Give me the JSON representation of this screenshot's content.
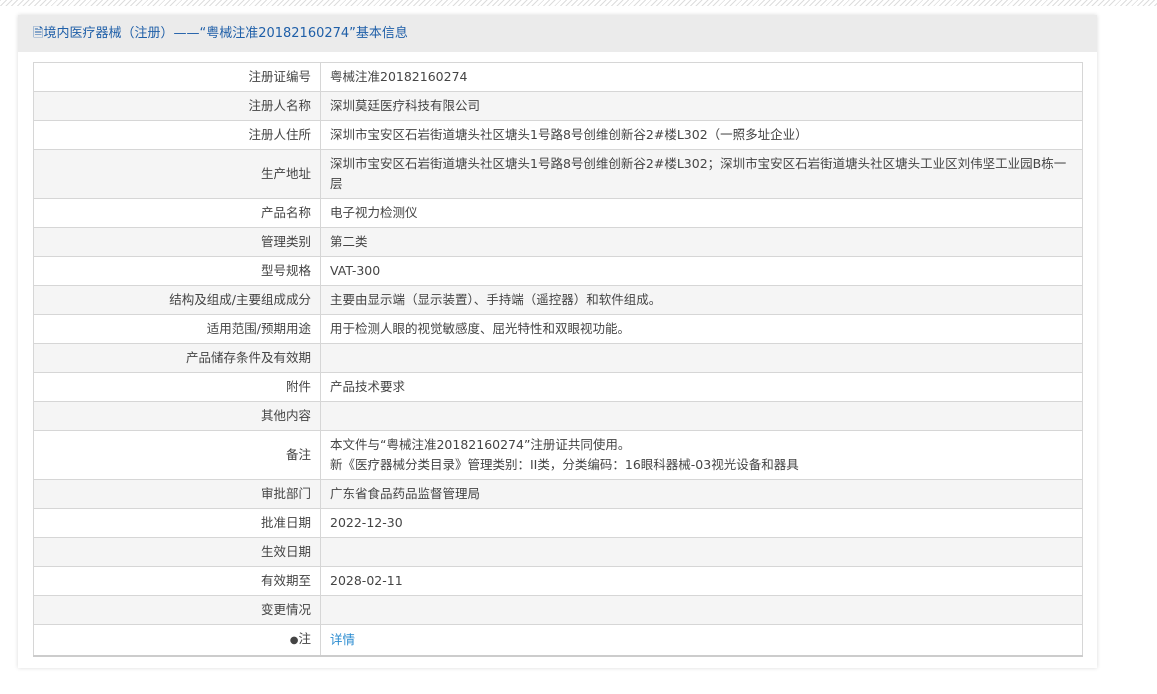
{
  "title": "境内医疗器械（注册）——“粤械注准20182160274”基本信息",
  "rows": [
    {
      "label": "注册证编号",
      "value": "粤械注准20182160274"
    },
    {
      "label": "注册人名称",
      "value": "深圳莫廷医疗科技有限公司"
    },
    {
      "label": "注册人住所",
      "value": "深圳市宝安区石岩街道塘头社区塘头1号路8号创维创新谷2#楼L302（一照多址企业）"
    },
    {
      "label": "生产地址",
      "value": "深圳市宝安区石岩街道塘头社区塘头1号路8号创维创新谷2#楼L302；深圳市宝安区石岩街道塘头社区塘头工业区刘伟坚工业园B栋一层"
    },
    {
      "label": "产品名称",
      "value": "电子视力检测仪"
    },
    {
      "label": "管理类别",
      "value": "第二类"
    },
    {
      "label": "型号规格",
      "value": "VAT-300"
    },
    {
      "label": "结构及组成/主要组成成分",
      "value": "主要由显示端（显示装置）、手持端（遥控器）和软件组成。"
    },
    {
      "label": "适用范围/预期用途",
      "value": "用于检测人眼的视觉敏感度、屈光特性和双眼视功能。"
    },
    {
      "label": "产品储存条件及有效期",
      "value": ""
    },
    {
      "label": "附件",
      "value": "产品技术要求"
    },
    {
      "label": "其他内容",
      "value": ""
    },
    {
      "label": "备注",
      "value": "本文件与“粤械注准20182160274”注册证共同使用。",
      "value2": "新《医疗器械分类目录》管理类别：II类，分类编码：16眼科器械-03视光设备和器具"
    },
    {
      "label": "审批部门",
      "value": "广东省食品药品监督管理局"
    },
    {
      "label": "批准日期",
      "value": "2022-12-30"
    },
    {
      "label": "生效日期",
      "value": ""
    },
    {
      "label": "有效期至",
      "value": "2028-02-11"
    },
    {
      "label": "变更情况",
      "value": ""
    },
    {
      "label": "注",
      "value": "详情"
    }
  ]
}
